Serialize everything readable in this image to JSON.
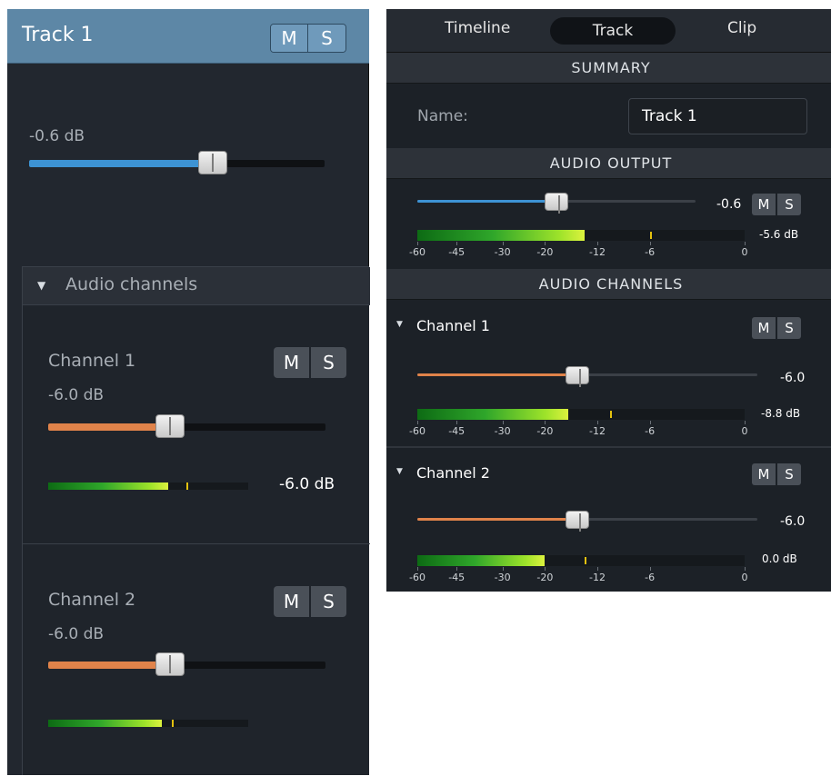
{
  "left": {
    "track_title": "Track 1",
    "mute_label": "M",
    "solo_label": "S",
    "volume_label": "-0.6 dB",
    "volume_level": 0.62,
    "audio_channels_label": "Audio channels",
    "channels": [
      {
        "name": "Channel 1",
        "gain_label": "-6.0 dB",
        "level": 0.44,
        "meter_fill": 0.6,
        "meter_peak": 0.69,
        "meter_value": "-6.0 dB"
      },
      {
        "name": "Channel 2",
        "gain_label": "-6.0 dB",
        "level": 0.44,
        "meter_fill": 0.57,
        "meter_peak": 0.62,
        "meter_value": ""
      }
    ]
  },
  "right": {
    "tabs": [
      "Timeline",
      "Track",
      "Clip"
    ],
    "active_tab": "Track",
    "summary_header": "SUMMARY",
    "name_label": "Name:",
    "name_value": "Track 1",
    "audio_output_header": "AUDIO OUTPUT",
    "output": {
      "level": 0.5,
      "value": "-0.6",
      "meter_fill": 0.51,
      "meter_peak": 0.71,
      "meter_value": "-5.6 dB"
    },
    "audio_channels_header": "AUDIO CHANNELS",
    "scale_labels": [
      "-60",
      "-45",
      "-30",
      "-20",
      "-12",
      "-6",
      "0"
    ],
    "mute_label": "M",
    "solo_label": "S",
    "channels": [
      {
        "name": "Channel 1",
        "level": 0.47,
        "value": "-6.0",
        "meter_fill": 0.46,
        "meter_peak": 0.59,
        "meter_value": "-8.8 dB"
      },
      {
        "name": "Channel 2",
        "level": 0.47,
        "value": "-6.0",
        "meter_fill": 0.39,
        "meter_peak": 0.51,
        "meter_value": "0.0 dB"
      }
    ]
  },
  "colors": {
    "volume_fill": "#3d93d4",
    "channel_fill": "#e0834a",
    "header_blue": "#5d87a6",
    "meter_peak": "#e3c10f"
  }
}
